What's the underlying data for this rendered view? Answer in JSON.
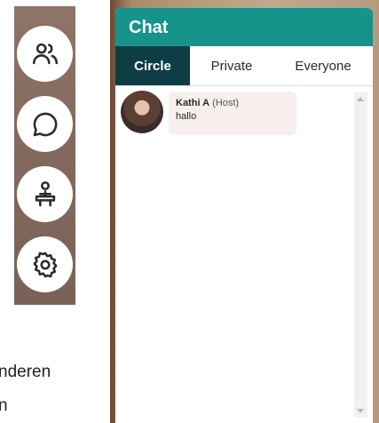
{
  "toolbar": {
    "buttons": [
      {
        "name": "participants",
        "icon": "people-icon"
      },
      {
        "name": "chat",
        "icon": "chat-bubble-icon"
      },
      {
        "name": "presenter",
        "icon": "podium-icon"
      },
      {
        "name": "settings",
        "icon": "gear-icon"
      }
    ]
  },
  "background_text": {
    "line1": "nderen",
    "line2": "n"
  },
  "chat": {
    "title": "Chat",
    "tabs": [
      {
        "label": "Circle",
        "active": true
      },
      {
        "label": "Private",
        "active": false
      },
      {
        "label": "Everyone",
        "active": false
      }
    ],
    "messages": [
      {
        "sender": "Kathi A",
        "role": "(Host)",
        "text": "hallo"
      }
    ]
  },
  "colors": {
    "header": "#16948c",
    "active_tab": "#0f3d45",
    "bubble": "#f6efed"
  }
}
